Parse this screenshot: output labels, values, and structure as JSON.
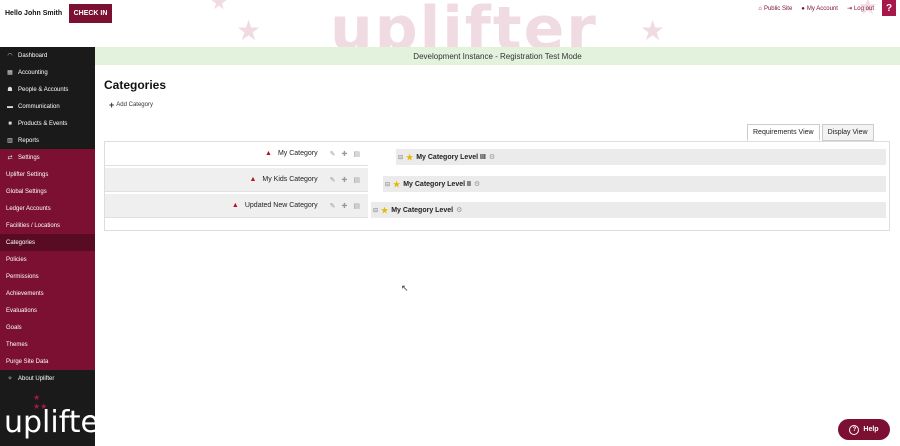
{
  "header": {
    "greeting": "Hello John Smith",
    "checkin_label": "CHECK IN",
    "links": [
      {
        "icon": "home-icon",
        "label": "Public Site"
      },
      {
        "icon": "user-icon",
        "label": "My Account"
      },
      {
        "icon": "logout-icon",
        "label": "Log out"
      }
    ],
    "help_corner": "?",
    "bg_logo": "uplifter"
  },
  "sidebar": {
    "items": [
      {
        "icon": "dashboard-icon",
        "label": "Dashboard"
      },
      {
        "icon": "accounting-icon",
        "label": "Accounting"
      },
      {
        "icon": "people-icon",
        "label": "People & Accounts"
      },
      {
        "icon": "communication-icon",
        "label": "Communication"
      },
      {
        "icon": "products-icon",
        "label": "Products & Events"
      },
      {
        "icon": "reports-icon",
        "label": "Reports"
      },
      {
        "icon": "settings-icon",
        "label": "Settings"
      }
    ],
    "settings_sub": [
      "Uplifter Settings",
      "Global Settings",
      "Ledger Accounts",
      "Facilities / Locations",
      "Categories",
      "Policies",
      "Permissions",
      "Achievements",
      "Evaluations",
      "Goals",
      "Themes",
      "Purge Site Data"
    ],
    "about": {
      "icon": "about-icon",
      "label": "About Uplifter"
    },
    "logo": "uplifter"
  },
  "banner": "Development Instance - Registration Test Mode",
  "main": {
    "title": "Categories",
    "add_label": "Add Category",
    "tabs": [
      "Requirements View",
      "Display View"
    ],
    "categories": [
      "My Category",
      "My Kids Category",
      "Updated New Category"
    ],
    "tree": [
      "My Category Level III",
      "My Category Level II",
      "My Category Level"
    ]
  },
  "help_button": "Help",
  "colors": {
    "brand": "#7b1033",
    "banner": "#e2f2dc",
    "sidebar": "#1a1a1a"
  }
}
